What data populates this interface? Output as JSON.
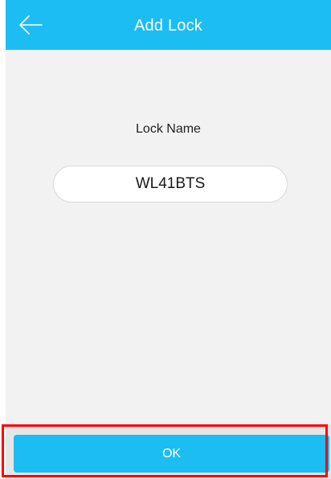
{
  "header": {
    "title": "Add Lock",
    "back_icon": "arrow-left-icon"
  },
  "form": {
    "label": "Lock Name",
    "lock_name_value": "WL41BTS"
  },
  "footer": {
    "ok_label": "OK"
  },
  "colors": {
    "accent": "#1cbdf3",
    "background": "#f2f2f2",
    "highlight": "#ff0000"
  }
}
